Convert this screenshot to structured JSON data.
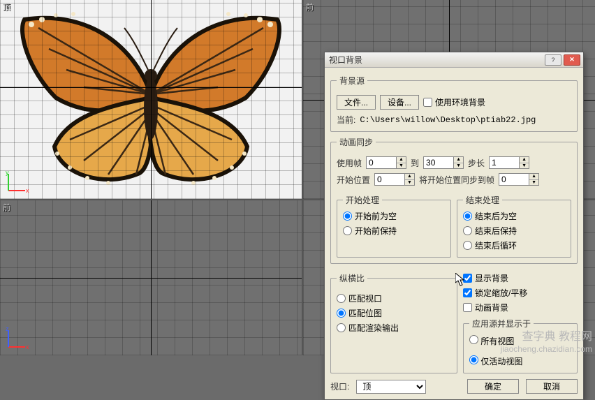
{
  "viewports": {
    "tl_label": "顶",
    "tr_label": "前",
    "bl_label": "前",
    "br_label": ""
  },
  "dialog": {
    "title": "视口背景",
    "bg_source": {
      "legend": "背景源",
      "file_btn": "文件...",
      "device_btn": "设备...",
      "use_env": "使用环境背景",
      "current_label": "当前:",
      "current_path": "C:\\Users\\willow\\Desktop\\ptiab22.jpg"
    },
    "anim_sync": {
      "legend": "动画同步",
      "use_frame": "使用帧",
      "use_frame_val": "0",
      "to": "到",
      "to_val": "30",
      "step": "步长",
      "step_val": "1",
      "start_pos": "开始位置",
      "start_pos_val": "0",
      "sync_start": "将开始位置同步到帧",
      "sync_start_val": "0",
      "start_proc": {
        "legend": "开始处理",
        "before_blank": "开始前为空",
        "before_hold": "开始前保持"
      },
      "end_proc": {
        "legend": "结束处理",
        "after_blank": "结束后为空",
        "after_hold": "结束后保持",
        "after_loop": "结束后循环"
      }
    },
    "aspect": {
      "legend": "纵横比",
      "match_viewport": "匹配视口",
      "match_bitmap": "匹配位图",
      "match_render": "匹配渲染输出"
    },
    "display_opts": {
      "show_bg": "显示背景",
      "lock_zoom": "锁定缩放/平移",
      "anim_bg": "动画背景",
      "apply_label": "应用源并显示于",
      "all_views": "所有视图",
      "active_only": "仅活动视图"
    },
    "viewport_label": "视口:",
    "viewport_value": "顶",
    "ok": "确定",
    "cancel": "取消"
  },
  "watermark": {
    "line1": "查字典 教程网",
    "line2": "jiaocheng.chazidian.com"
  }
}
